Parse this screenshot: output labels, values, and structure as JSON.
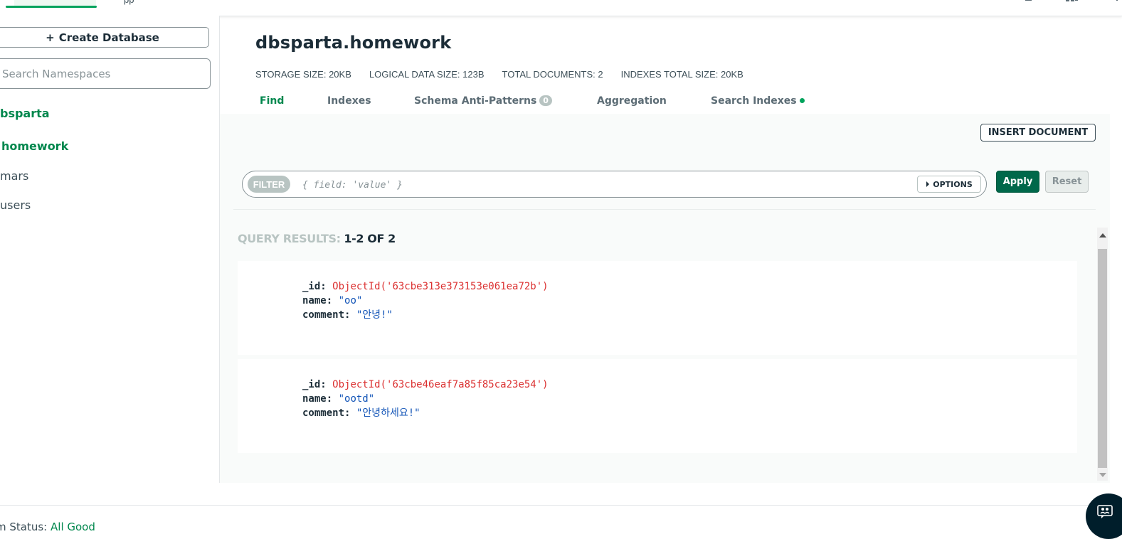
{
  "topbar": {
    "cut_text": "pp"
  },
  "sidebar": {
    "create_database_label": "Create Database",
    "search_placeholder": "Search Namespaces",
    "database": "bsparta",
    "collections": [
      {
        "label": "homework",
        "active": true
      },
      {
        "label": "mars",
        "active": false
      },
      {
        "label": "users",
        "active": false
      }
    ]
  },
  "header": {
    "namespace_title": "dbsparta.homework",
    "stats": [
      {
        "key": "STORAGE SIZE:",
        "value": "20KB"
      },
      {
        "key": "LOGICAL DATA SIZE:",
        "value": "123B"
      },
      {
        "key": "TOTAL DOCUMENTS:",
        "value": "2"
      },
      {
        "key": "INDEXES TOTAL SIZE:",
        "value": "20KB"
      }
    ]
  },
  "tabs": [
    {
      "label": "Find",
      "active": true
    },
    {
      "label": "Indexes"
    },
    {
      "label": "Schema Anti-Patterns",
      "badge": "0"
    },
    {
      "label": "Aggregation"
    },
    {
      "label": "Search Indexes",
      "dot": true
    }
  ],
  "toolbar": {
    "insert_document_label": "INSERT DOCUMENT",
    "filter_label": "FILTER",
    "filter_placeholder": "{ field: 'value' }",
    "options_label": "OPTIONS",
    "apply_label": "Apply",
    "reset_label": "Reset"
  },
  "results": {
    "label": "QUERY RESULTS:",
    "count": "1-2 OF 2",
    "documents": [
      {
        "id_key": "_id:",
        "id_value": "ObjectId('63cbe313e373153e061ea72b')",
        "name_key": "name:",
        "name_value": "\"oo\"",
        "comment_key": "comment:",
        "comment_value": "\"안녕!\""
      },
      {
        "id_key": "_id:",
        "id_value": "ObjectId('63cbe46eaf7a85f85ca23e54')",
        "name_key": "name:",
        "name_value": "\"ootd\"",
        "comment_key": "comment:",
        "comment_value": "\"안녕하세요!\""
      }
    ]
  },
  "footer": {
    "status_label": "m Status:",
    "status_value": "All Good"
  },
  "colors": {
    "brand_green": "#00874d",
    "apply_green": "#00684a",
    "object_id_red": "#db3030",
    "string_blue": "#1254b7"
  }
}
